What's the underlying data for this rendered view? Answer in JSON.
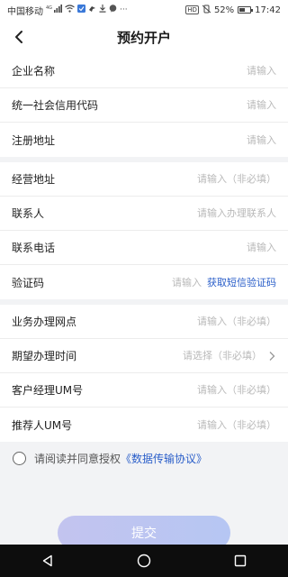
{
  "status_bar": {
    "carrier": "中国移动",
    "signal_label": "4G",
    "hd_label": "HD",
    "battery": "52%",
    "battery_level": 0.52,
    "time": "17:42",
    "overflow": "···"
  },
  "header": {
    "title": "预约开户"
  },
  "sections": [
    {
      "rows": [
        {
          "label": "企业名称",
          "placeholder": "请输入"
        },
        {
          "label": "统一社会信用代码",
          "placeholder": "请输入"
        },
        {
          "label": "注册地址",
          "placeholder": "请输入"
        }
      ]
    },
    {
      "rows": [
        {
          "label": "经营地址",
          "placeholder": "请输入（非必填）"
        },
        {
          "label": "联系人",
          "placeholder": "请输入办理联系人"
        },
        {
          "label": "联系电话",
          "placeholder": "请输入"
        },
        {
          "label": "验证码",
          "placeholder": "请输入",
          "action": "获取短信验证码"
        }
      ]
    },
    {
      "rows": [
        {
          "label": "业务办理网点",
          "placeholder": "请输入（非必填）"
        },
        {
          "label": "期望办理时间",
          "placeholder": "请选择（非必填）"
        },
        {
          "label": "客户经理UM号",
          "placeholder": "请输入（非必填）"
        },
        {
          "label": "推荐人UM号",
          "placeholder": "请输入（非必填）"
        }
      ]
    }
  ],
  "agreement": {
    "prefix": "请阅读并同意授权",
    "link": "《数据传输协议》"
  },
  "submit_label": "提交",
  "colors": {
    "link": "#2a5ec9",
    "submit_start": "#c3c4ef",
    "submit_end": "#b6c6f3",
    "background": "#f2f3f5"
  }
}
